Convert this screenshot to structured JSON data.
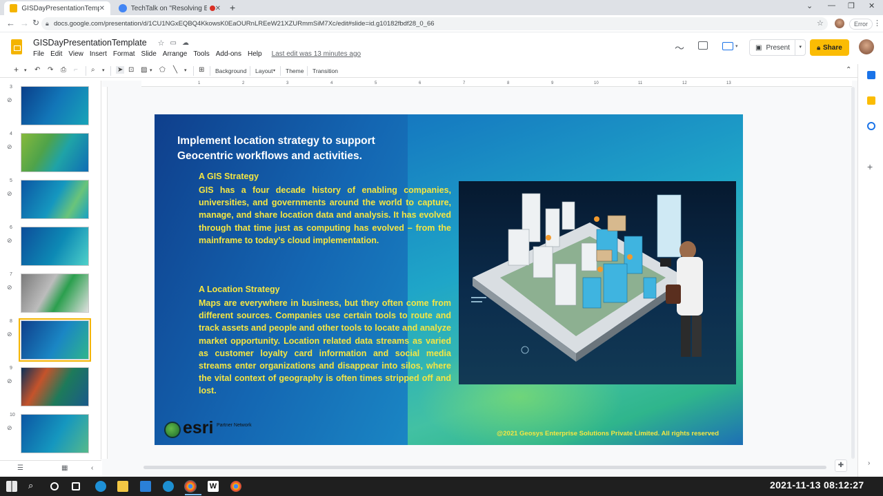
{
  "browser": {
    "tabs": [
      {
        "title": "GISDayPresentationTemplate - G",
        "active": true,
        "icon": "slides-icon"
      },
      {
        "title": "TechTalk on \"Resolving Busin",
        "active": false,
        "icon": "meet-icon",
        "recording": true
      }
    ],
    "url": "docs.google.com/presentation/d/1CU1NGxEQBQ4KkowsK0EaOURnLREeW21XZURmmSiM7Xc/edit#slide=id.g10182fbdf28_0_66",
    "error_label": "Error"
  },
  "doc": {
    "title": "GISDayPresentationTemplate",
    "menu": [
      "File",
      "Edit",
      "View",
      "Insert",
      "Format",
      "Slide",
      "Arrange",
      "Tools",
      "Add-ons",
      "Help"
    ],
    "last_edit": "Last edit was 13 minutes ago",
    "present_label": "Present",
    "share_label": "Share"
  },
  "toolbar": {
    "background_label": "Background",
    "layout_label": "Layout",
    "theme_label": "Theme",
    "transition_label": "Transition"
  },
  "filmstrip": {
    "slides": [
      {
        "num": "3"
      },
      {
        "num": "4"
      },
      {
        "num": "5"
      },
      {
        "num": "6"
      },
      {
        "num": "7"
      },
      {
        "num": "8",
        "selected": true
      },
      {
        "num": "9"
      },
      {
        "num": "10"
      }
    ]
  },
  "ruler": {
    "ticks": [
      "1",
      "2",
      "3",
      "4",
      "5",
      "6",
      "7",
      "8",
      "9",
      "10",
      "11",
      "12",
      "13"
    ]
  },
  "slide": {
    "title_line1": "Implement location strategy to support",
    "title_line2": "Geocentric workflows and activities.",
    "section1_heading": "A GIS Strategy",
    "section1_body": "GIS has a four decade history of enabling companies, universities, and governments around the world to capture, manage, and share location data and analysis. It has evolved through that time just as computing has evolved – from the mainframe to today’s cloud implementation.",
    "section2_heading": "A Location Strategy",
    "section2_body": "Maps are everywhere in business, but they often come from different sources. Companies use certain tools to route and track assets and people and other tools to locate and analyze market opportunity. Location related data streams as varied as customer loyalty card information and social media streams enter organizations and disappear into silos, where the vital context of geography is often times stripped off and lost.",
    "logo_text": "esri",
    "partner_label": "Partner Network",
    "copyright": "@2021 Geosys Enterprise Solutions Private Limited. All rights reserved"
  },
  "taskbar": {
    "clock": "2021-11-13  08:12:27"
  },
  "colors": {
    "accent_yellow": "#f5e642",
    "slides_brand": "#f4b400",
    "share_button": "#fbbc04"
  }
}
